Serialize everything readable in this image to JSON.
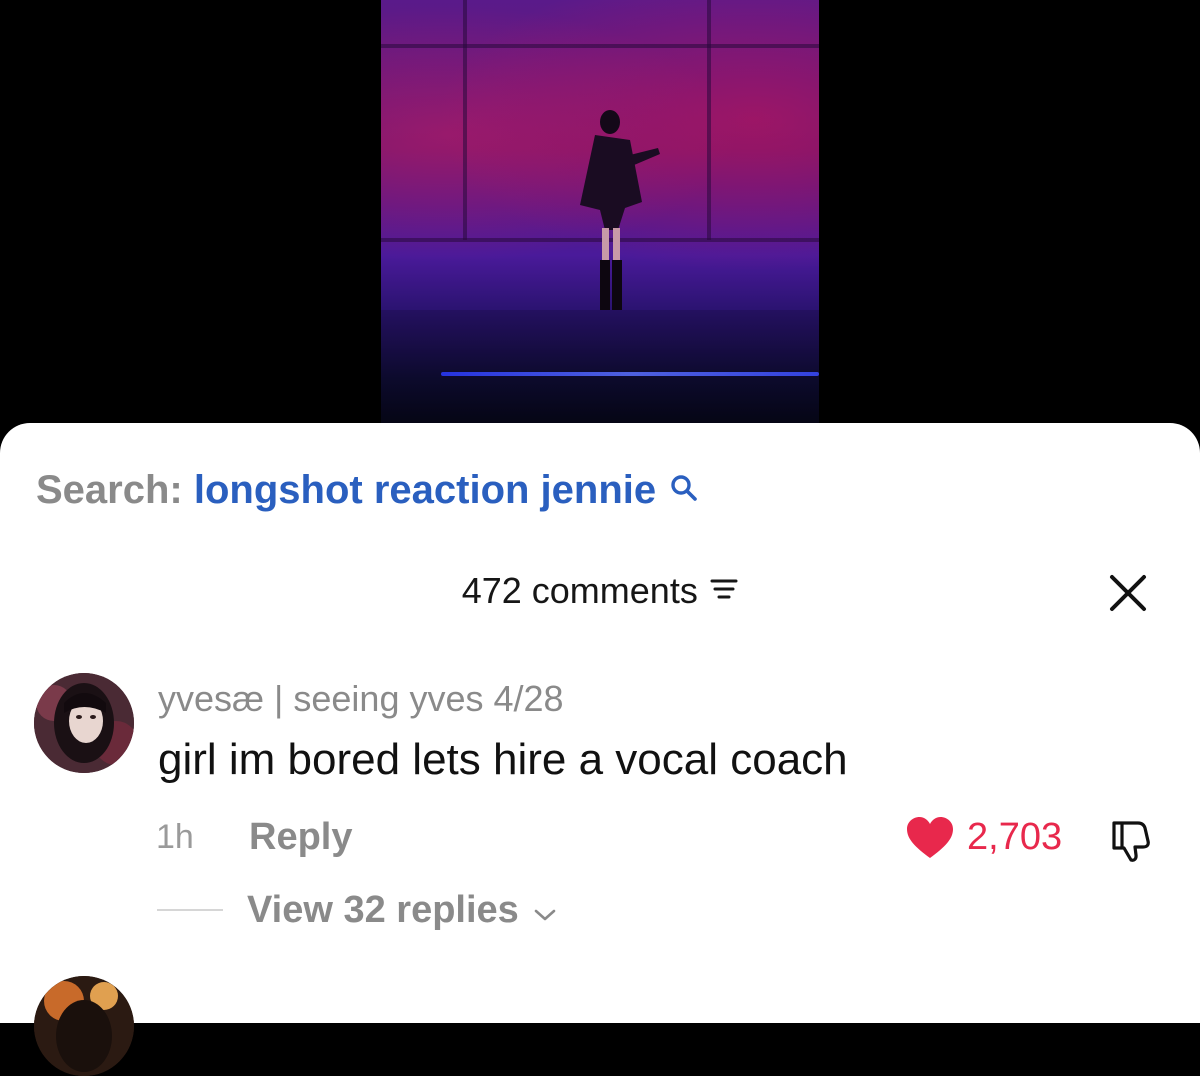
{
  "search": {
    "prefix": "Search:",
    "query": "longshot reaction jennie"
  },
  "comments_header": {
    "count_label": "472 comments"
  },
  "comments": [
    {
      "username": "yvesæ | seeing yves 4/28",
      "text": "girl im bored lets hire a vocal coach",
      "time": "1h",
      "reply_label": "Reply",
      "likes": "2,703",
      "view_replies_label": "View 32 replies"
    }
  ],
  "colors": {
    "link_blue": "#2a5fbf",
    "like_red": "#e8284c",
    "muted_gray": "#8a8a8a"
  },
  "icons": [
    "search-icon",
    "filter-icon",
    "close-icon",
    "heart-icon",
    "dislike-icon",
    "chevron-down-icon"
  ]
}
